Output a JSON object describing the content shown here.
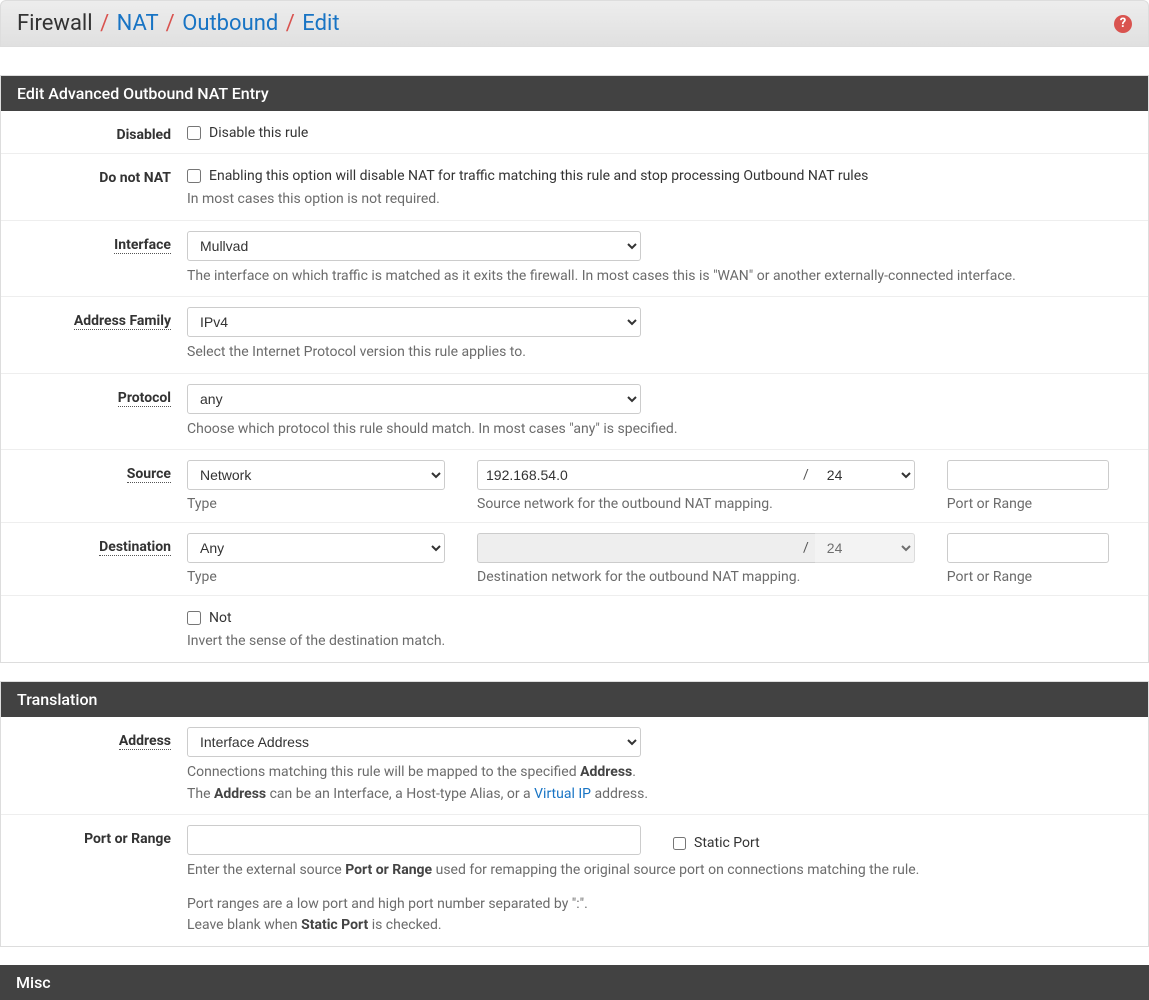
{
  "breadcrumb": {
    "root": "Firewall",
    "level1": "NAT",
    "level2": "Outbound",
    "current": "Edit"
  },
  "panels": {
    "edit": {
      "title": "Edit Advanced Outbound NAT Entry",
      "disabled": {
        "label": "Disabled",
        "checkbox": "Disable this rule"
      },
      "donotnat": {
        "label": "Do not NAT",
        "checkbox": "Enabling this option will disable NAT for traffic matching this rule and stop processing Outbound NAT rules",
        "help": "In most cases this option is not required."
      },
      "interface": {
        "label": "Interface",
        "value": "Mullvad",
        "help": "The interface on which traffic is matched as it exits the firewall. In most cases this is \"WAN\" or another externally-connected interface."
      },
      "addressfamily": {
        "label": "Address Family",
        "value": "IPv4",
        "help": "Select the Internet Protocol version this rule applies to."
      },
      "protocol": {
        "label": "Protocol",
        "value": "any",
        "help": "Choose which protocol this rule should match. In most cases \"any\" is specified."
      },
      "source": {
        "label": "Source",
        "type_value": "Network",
        "type_sub": "Type",
        "net_value": "192.168.54.0",
        "mask_value": "24",
        "net_sub": "Source network for the outbound NAT mapping.",
        "port_sub": "Port or Range"
      },
      "destination": {
        "label": "Destination",
        "type_value": "Any",
        "type_sub": "Type",
        "net_value": "",
        "mask_value": "24",
        "net_sub": "Destination network for the outbound NAT mapping.",
        "port_sub": "Port or Range"
      },
      "not": {
        "checkbox": "Not",
        "help": "Invert the sense of the destination match."
      }
    },
    "translation": {
      "title": "Translation",
      "address": {
        "label": "Address",
        "value": "Interface Address",
        "help1_pre": "Connections matching this rule will be mapped to the specified ",
        "help1_strong": "Address",
        "help1_post": ".",
        "help2_a": "The ",
        "help2_strong": "Address",
        "help2_b": " can be an Interface, a Host-type Alias, or a ",
        "help2_link": "Virtual IP",
        "help2_c": " address."
      },
      "portrange": {
        "label": "Port or Range",
        "static_label": "Static Port",
        "help1_a": "Enter the external source ",
        "help1_strong": "Port or Range",
        "help1_b": " used for remapping the original source port on connections matching the rule.",
        "help2": "Port ranges are a low port and high port number separated by \":\".",
        "help3_a": "Leave blank when ",
        "help3_strong": "Static Port",
        "help3_b": " is checked."
      }
    },
    "misc": {
      "title": "Misc"
    }
  },
  "slash": "/"
}
